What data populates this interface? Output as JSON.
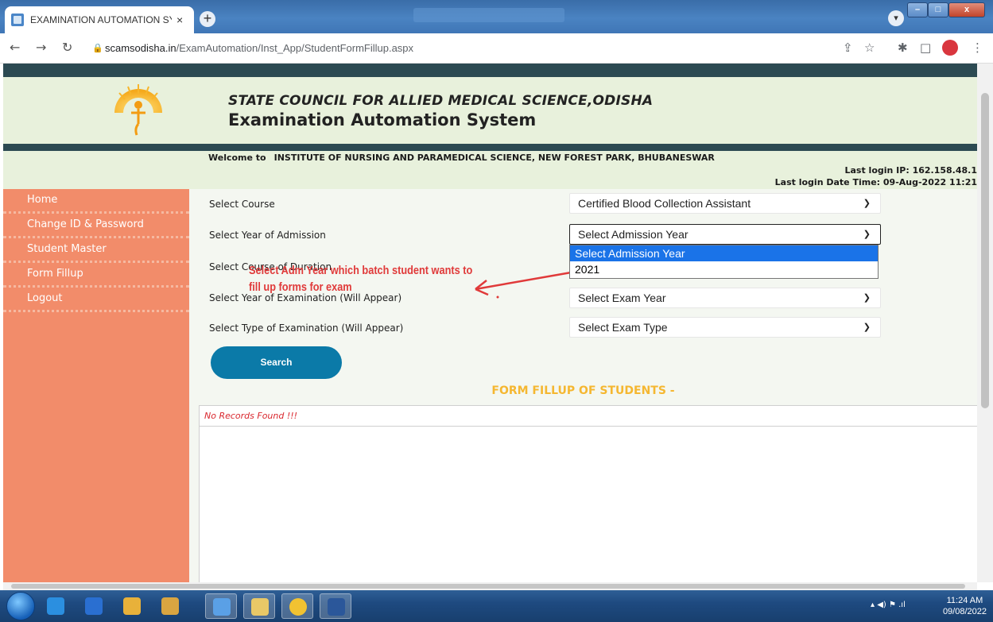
{
  "browser": {
    "tab_title": "EXAMINATION AUTOMATION SY",
    "tab_close": "×",
    "new_tab": "+",
    "url_host": "scamsodisha.in",
    "url_path": "/ExamAutomation/Inst_App/StudentFormFillup.aspx",
    "window_min": "–",
    "window_max": "□",
    "window_close": "x"
  },
  "header": {
    "org_name": "STATE COUNCIL FOR ALLIED MEDICAL SCIENCE,ODISHA",
    "system_name": "Examination Automation System"
  },
  "session": {
    "welcome_prefix": "Welcome to",
    "institute": "INSTITUTE OF NURSING AND PARAMEDICAL SCIENCE, NEW FOREST PARK, BHUBANESWAR",
    "last_login_ip": "Last login IP:  162.158.48.1",
    "last_login_dt": "Last login Date Time: 09-Aug-2022 11:21"
  },
  "sidebar": {
    "items": [
      {
        "label": "Home"
      },
      {
        "label": "Change ID & Password"
      },
      {
        "label": "Student Master"
      },
      {
        "label": "Form Fillup"
      },
      {
        "label": "Logout"
      }
    ]
  },
  "form": {
    "course_label": "Select Course",
    "course_value": "Certified Blood Collection Assistant",
    "admission_label": "Select Year of Admission",
    "admission_value": "Select Admission Year",
    "duration_label": "Select Course of Duration",
    "exam_year_label": "Select Year of Examination (Will Appear)",
    "exam_year_value": "Select Exam Year",
    "exam_type_label": "Select Type of Examination (Will Appear)",
    "exam_type_value": "Select Exam Type",
    "search_label": "Search",
    "admission_options": [
      "Select Admission Year",
      "2021"
    ]
  },
  "annotation": {
    "line1": "Select Adm Year which batch student wants to",
    "line2": "fill up forms for exam"
  },
  "results": {
    "section_title": "FORM FILLUP OF STUDENTS -",
    "empty_message": "No Records Found !!!"
  },
  "taskbar": {
    "time": "11:24 AM",
    "date": "09/08/2022"
  },
  "colors": {
    "sidebar": "#f28c6a",
    "header_band": "#2c4a52",
    "header_bg": "#e8f1dc",
    "search_button": "#0b7aa8",
    "section_title": "#f5b731",
    "annotation": "#e03a3a",
    "dropdown_highlight": "#1a73e8"
  }
}
